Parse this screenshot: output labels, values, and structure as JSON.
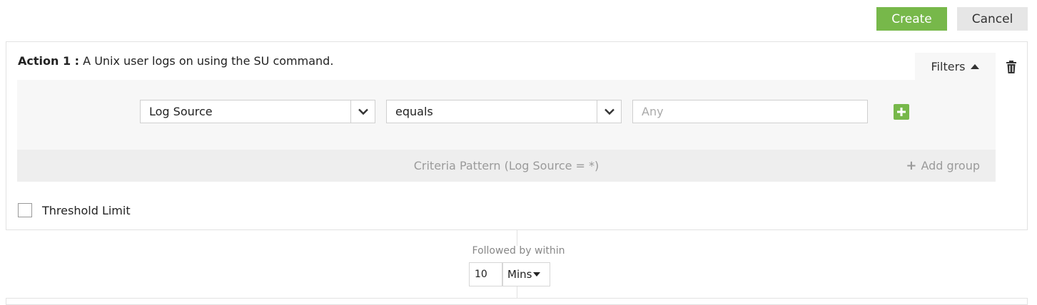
{
  "toolbar": {
    "create_label": "Create",
    "cancel_label": "Cancel"
  },
  "action": {
    "prefix": "Action 1 :",
    "description": "A Unix user logs on using the SU command.",
    "filters_label": "Filters",
    "field_select": "Log Source",
    "operator_select": "equals",
    "value_placeholder": "Any",
    "criteria_pattern": "Criteria Pattern (Log Source = *)",
    "add_group_label": "Add group",
    "threshold_label": "Threshold Limit",
    "threshold_checked": false
  },
  "followed": {
    "label": "Followed by within",
    "value": "10",
    "unit": "Mins"
  },
  "colors": {
    "accent_green": "#77b84a",
    "panel_bg": "#f7f7f7",
    "criteria_bg": "#eeeeee"
  },
  "icons": {
    "trash": "trash-icon",
    "filters_toggle": "caret-up-icon",
    "select_arrow": "chevron-down-icon",
    "add_filter": "plus-icon",
    "add_group": "plus-icon",
    "unit_arrow": "caret-down-icon"
  }
}
